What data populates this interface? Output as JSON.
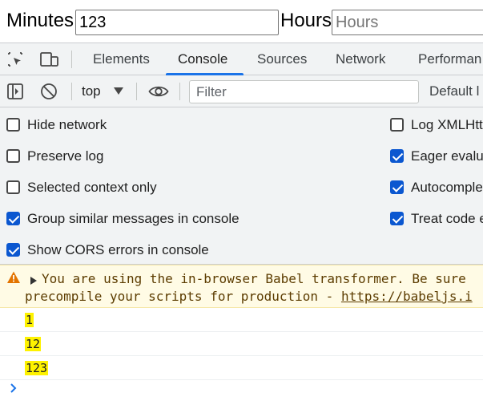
{
  "page": {
    "minutes_label": "Minutes",
    "minutes_value": "123",
    "hours_label": "Hours",
    "hours_placeholder": "Hours"
  },
  "devtools": {
    "tabs": [
      {
        "label": "Elements"
      },
      {
        "label": "Console",
        "active": true
      },
      {
        "label": "Sources"
      },
      {
        "label": "Network"
      },
      {
        "label": "Performan"
      }
    ],
    "toolbar": {
      "context": "top",
      "filter_placeholder": "Filter",
      "levels_label": "Default l"
    },
    "settings": {
      "left": [
        {
          "label": "Hide network",
          "checked": false
        },
        {
          "label": "Preserve log",
          "checked": false
        },
        {
          "label": "Selected context only",
          "checked": false
        },
        {
          "label": "Group similar messages in console",
          "checked": true
        },
        {
          "label": "Show CORS errors in console",
          "checked": true
        }
      ],
      "right": [
        {
          "label": "Log XMLHtt",
          "checked": false
        },
        {
          "label": "Eager evalu",
          "checked": true
        },
        {
          "label": "Autocomple",
          "checked": true
        },
        {
          "label": "Treat code e",
          "checked": true
        }
      ]
    },
    "console": {
      "warning_line1": "You are using the in-browser Babel transformer. Be sure",
      "warning_line2_text": "precompile your scripts for production - ",
      "warning_link": "https://babeljs.i",
      "logs": [
        "1",
        "12",
        "123"
      ]
    },
    "colors": {
      "accent": "#1a73e8",
      "checkbox_checked": "#0b57d0",
      "warning_bg": "#fffbe5",
      "warning_text": "#5c3c00",
      "log_highlight": "#fef200"
    }
  }
}
